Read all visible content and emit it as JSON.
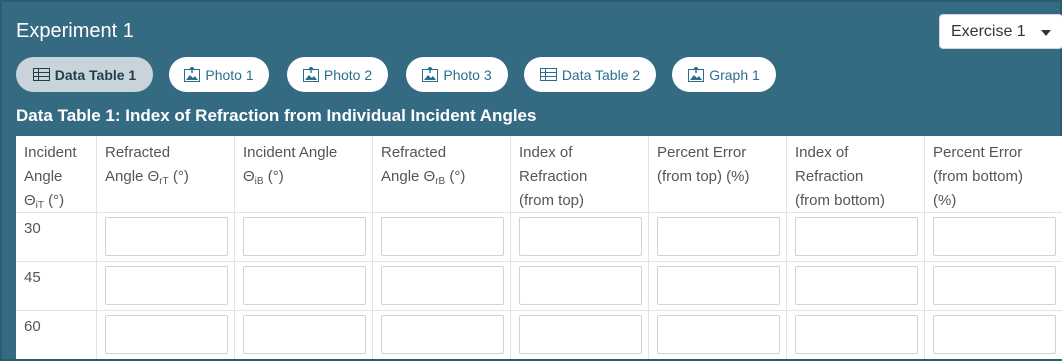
{
  "experiment": {
    "title": "Experiment 1"
  },
  "exercise_select": {
    "value": "Exercise 1"
  },
  "tabs": [
    {
      "label": "Data Table 1",
      "icon": "table-icon",
      "active": true
    },
    {
      "label": "Photo 1",
      "icon": "photo-icon",
      "active": false
    },
    {
      "label": "Photo 2",
      "icon": "photo-icon",
      "active": false
    },
    {
      "label": "Photo 3",
      "icon": "photo-icon",
      "active": false
    },
    {
      "label": "Data Table 2",
      "icon": "table-icon",
      "active": false
    },
    {
      "label": "Graph 1",
      "icon": "photo-icon",
      "active": false
    }
  ],
  "table": {
    "title": "Data Table 1: Index of Refraction from Individual Incident Angles",
    "headers": [
      {
        "lines": [
          "Incident",
          "Angle"
        ],
        "symbol": "Θ",
        "sub": "iT",
        "unit": " (°)"
      },
      {
        "lines": [
          "Refracted"
        ],
        "prefix": "Angle ",
        "symbol": "Θ",
        "sub": "rT",
        "unit": " (°)"
      },
      {
        "lines": [
          "Incident Angle"
        ],
        "symbol": "Θ",
        "sub": "iB",
        "unit": " (°)"
      },
      {
        "lines": [
          "Refracted"
        ],
        "prefix": "Angle ",
        "symbol": "Θ",
        "sub": "rB",
        "unit": " (°)"
      },
      {
        "lines": [
          "Index of",
          "Refraction",
          "(from top)"
        ]
      },
      {
        "lines": [
          "Percent Error",
          "(from top) (%)"
        ]
      },
      {
        "lines": [
          "Index of",
          "Refraction",
          "(from bottom)"
        ]
      },
      {
        "lines": [
          "Percent Error",
          "(from bottom)",
          "(%)"
        ]
      }
    ],
    "rows": [
      {
        "angle": "30",
        "values": [
          "",
          "",
          "",
          "",
          "",
          "",
          ""
        ]
      },
      {
        "angle": "45",
        "values": [
          "",
          "",
          "",
          "",
          "",
          "",
          ""
        ]
      },
      {
        "angle": "60",
        "values": [
          "",
          "",
          "",
          "",
          "",
          "",
          ""
        ]
      }
    ]
  },
  "colors": {
    "panel_background": "#356a83",
    "active_tab": "#c8d4da",
    "tab_text": "#2a6d8c"
  }
}
